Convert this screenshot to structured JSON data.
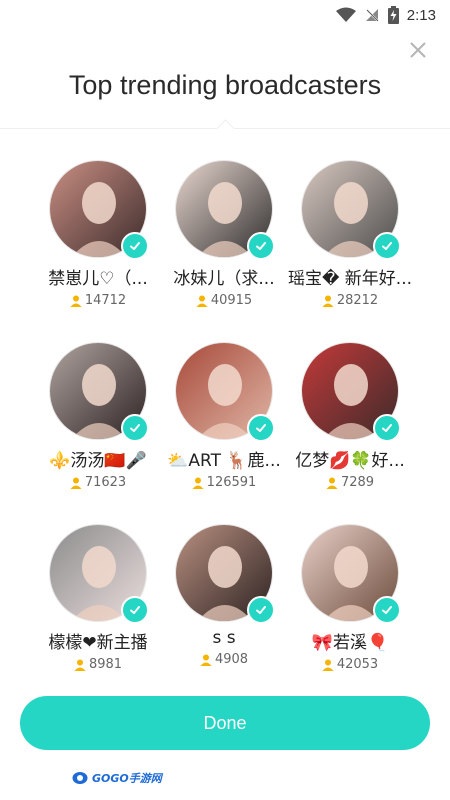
{
  "status_bar": {
    "time": "2:13"
  },
  "title": "Top trending broadcasters",
  "broadcasters": [
    {
      "name": "禁崽儿♡（...",
      "followers": "14712",
      "palette": [
        "#c98f83",
        "#3a2a2a"
      ]
    },
    {
      "name": "冰妹儿（求...",
      "followers": "40915",
      "palette": [
        "#e9d7cf",
        "#2b2b2b"
      ]
    },
    {
      "name": "瑶宝� 新年好...",
      "followers": "28212",
      "palette": [
        "#d8c8c0",
        "#4a4a4a"
      ]
    },
    {
      "name": "⚜️汤汤🇨🇳🎤",
      "followers": "71623",
      "palette": [
        "#b0a4a0",
        "#2a2020"
      ]
    },
    {
      "name": "⛅ART 🦌鹿...",
      "followers": "126591",
      "palette": [
        "#a84a3a",
        "#e0b8a8"
      ]
    },
    {
      "name": "亿梦💋🍀好...",
      "followers": "7289",
      "palette": [
        "#c43a3a",
        "#3a2a2a"
      ]
    },
    {
      "name": "檬檬❤新主播",
      "followers": "8981",
      "palette": [
        "#8c8c8c",
        "#ecdede"
      ]
    },
    {
      "name": "s s",
      "followers": "4908",
      "palette": [
        "#b89080",
        "#2a2020"
      ]
    },
    {
      "name": "🎀若溪🎈",
      "followers": "42053",
      "palette": [
        "#e8d0c8",
        "#6a4a3a"
      ]
    }
  ],
  "done_label": "Done",
  "watermark": "GOGO手游网",
  "colors": {
    "accent": "#25d6c4",
    "follower_icon": "#f5b400"
  }
}
